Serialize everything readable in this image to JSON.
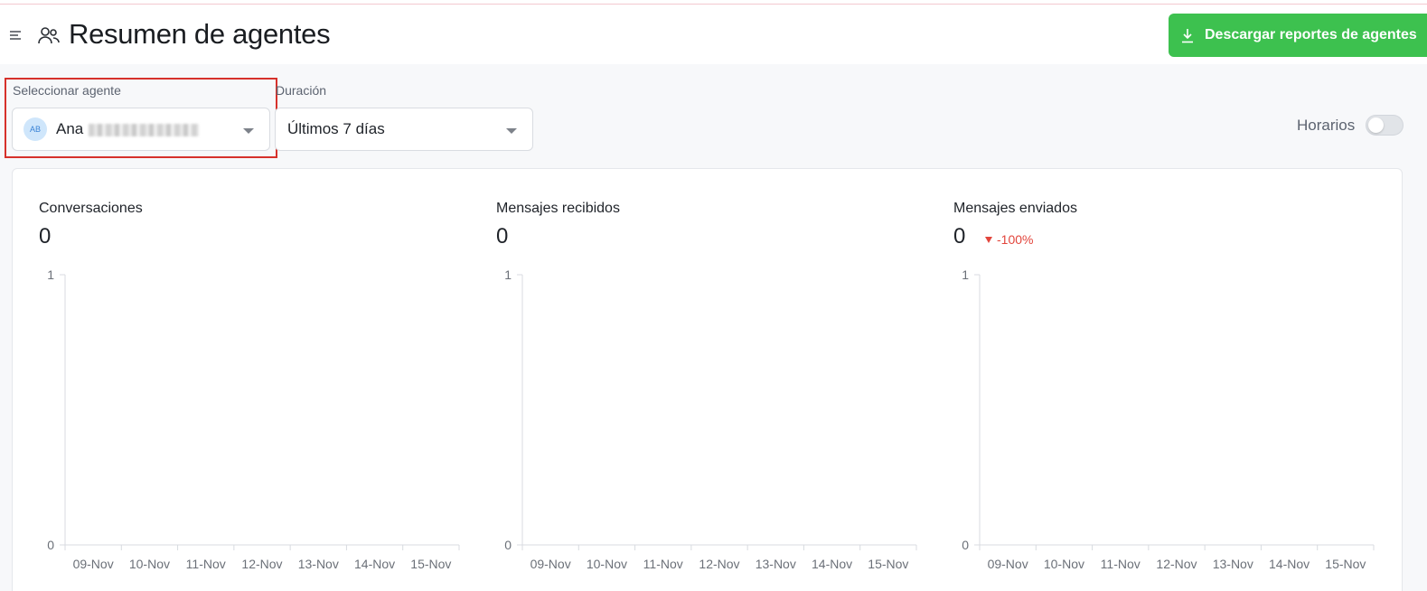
{
  "header": {
    "title": "Resumen de agentes",
    "download_label": "Descargar reportes de agentes"
  },
  "filters": {
    "agent_label": "Seleccionar agente",
    "agent_initials": "AB",
    "agent_name": "Ana",
    "duration_label": "Duración",
    "duration_value": "Últimos 7 días",
    "schedule_label": "Horarios",
    "schedule_enabled": false
  },
  "icons": {
    "menu": "menu-icon",
    "agents": "users-icon",
    "download": "download-icon",
    "dropdown": "caret-down-icon",
    "trend": "caret-down-icon"
  },
  "colors": {
    "primary_button": "#3dc14f",
    "negative": "#e2453c",
    "highlight": "#d6312b"
  },
  "metrics": [
    {
      "title": "Conversaciones",
      "value": "0",
      "change": ""
    },
    {
      "title": "Mensajes recibidos",
      "value": "0",
      "change": ""
    },
    {
      "title": "Mensajes enviados",
      "value": "0",
      "change": "-100%"
    }
  ],
  "chart_data": [
    {
      "type": "line",
      "categories": [
        "09-Nov",
        "10-Nov",
        "11-Nov",
        "12-Nov",
        "13-Nov",
        "14-Nov",
        "15-Nov"
      ],
      "values": [
        0,
        0,
        0,
        0,
        0,
        0,
        0
      ],
      "yticks": [
        0,
        1
      ],
      "ylim": [
        0,
        1
      ],
      "title": "",
      "xlabel": "",
      "ylabel": "",
      "grid": false
    },
    {
      "type": "line",
      "categories": [
        "09-Nov",
        "10-Nov",
        "11-Nov",
        "12-Nov",
        "13-Nov",
        "14-Nov",
        "15-Nov"
      ],
      "values": [
        0,
        0,
        0,
        0,
        0,
        0,
        0
      ],
      "yticks": [
        0,
        1
      ],
      "ylim": [
        0,
        1
      ],
      "title": "",
      "xlabel": "",
      "ylabel": "",
      "grid": false
    },
    {
      "type": "line",
      "categories": [
        "09-Nov",
        "10-Nov",
        "11-Nov",
        "12-Nov",
        "13-Nov",
        "14-Nov",
        "15-Nov"
      ],
      "values": [
        0,
        0,
        0,
        0,
        0,
        0,
        0
      ],
      "yticks": [
        0,
        1
      ],
      "ylim": [
        0,
        1
      ],
      "title": "",
      "xlabel": "",
      "ylabel": "",
      "grid": false
    }
  ]
}
